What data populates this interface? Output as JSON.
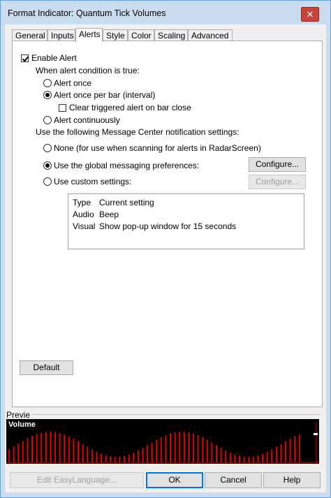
{
  "window": {
    "title": "Format Indicator: Quantum Tick Volumes",
    "close_glyph": "✕"
  },
  "tabs": [
    {
      "label": "General",
      "active": false
    },
    {
      "label": "Inputs",
      "active": false
    },
    {
      "label": "Alerts",
      "active": true
    },
    {
      "label": "Style",
      "active": false
    },
    {
      "label": "Color",
      "active": false
    },
    {
      "label": "Scaling",
      "active": false
    },
    {
      "label": "Advanced",
      "active": false
    }
  ],
  "alerts": {
    "enable_alert": {
      "label": "Enable Alert",
      "checked": true
    },
    "condition_heading": "When alert condition is true:",
    "alert_once": {
      "label": "Alert once",
      "checked": false
    },
    "alert_once_per_bar": {
      "label": "Alert once per bar (interval)",
      "checked": true
    },
    "clear_triggered": {
      "label": "Clear triggered alert on bar close",
      "checked": false
    },
    "alert_continuously": {
      "label": "Alert continuously",
      "checked": false
    },
    "message_center_heading": "Use the following Message Center notification settings:",
    "none_option": {
      "label": "None (for use when scanning for alerts in RadarScreen)",
      "checked": false
    },
    "global_option": {
      "label": "Use the global messaging preferences:",
      "checked": true
    },
    "custom_option": {
      "label": "Use custom settings:",
      "checked": false
    },
    "configure_label": "Configure...",
    "settings_table": {
      "header": {
        "k": "Type",
        "v": "Current setting"
      },
      "rows": [
        {
          "k": "Audio",
          "v": "Beep"
        },
        {
          "k": "Visual",
          "v": "Show pop-up window for 15 seconds"
        }
      ]
    },
    "default_label": "Default"
  },
  "preview": {
    "group_label": "Previe",
    "chart_title": "Volume",
    "bar_color": "#e00000"
  },
  "footer": {
    "edit_label": "Edit EasyLanguage...",
    "ok_label": "OK",
    "cancel_label": "Cancel",
    "help_label": "Help"
  }
}
